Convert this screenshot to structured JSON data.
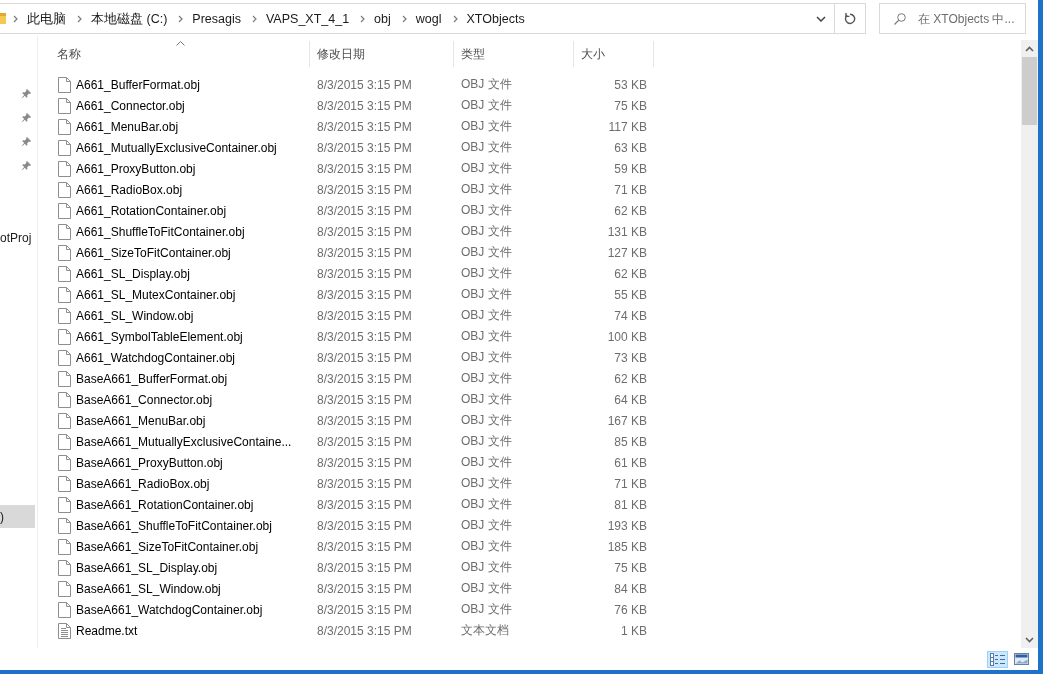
{
  "address_bar": {
    "breadcrumb": [
      "此电脑",
      "本地磁盘 (C:)",
      "Presagis",
      "VAPS_XT_4_1",
      "obj",
      "wogl",
      "XTObjects"
    ]
  },
  "search": {
    "placeholder": "在 XTObjects 中..."
  },
  "nav_pane": {
    "items": [
      {
        "kind": "pinned"
      },
      {
        "kind": "pinned"
      },
      {
        "kind": "pinned"
      },
      {
        "kind": "pinned"
      },
      {
        "kind": "folder",
        "label": "otProj",
        "selected": false
      },
      {
        "kind": "folder",
        "label": ")",
        "selected": true
      }
    ]
  },
  "table": {
    "columns": [
      {
        "label": "名称",
        "sorted": true
      },
      {
        "label": "修改日期",
        "sorted": false
      },
      {
        "label": "类型",
        "sorted": false
      },
      {
        "label": "大小",
        "sorted": false
      }
    ],
    "rows": [
      {
        "kind": "obj",
        "name": "A661_BufferFormat.obj",
        "modified": "8/3/2015 3:15 PM",
        "type": "OBJ 文件",
        "size": "53 KB"
      },
      {
        "kind": "obj",
        "name": "A661_Connector.obj",
        "modified": "8/3/2015 3:15 PM",
        "type": "OBJ 文件",
        "size": "75 KB"
      },
      {
        "kind": "obj",
        "name": "A661_MenuBar.obj",
        "modified": "8/3/2015 3:15 PM",
        "type": "OBJ 文件",
        "size": "117 KB"
      },
      {
        "kind": "obj",
        "name": "A661_MutuallyExclusiveContainer.obj",
        "modified": "8/3/2015 3:15 PM",
        "type": "OBJ 文件",
        "size": "63 KB"
      },
      {
        "kind": "obj",
        "name": "A661_ProxyButton.obj",
        "modified": "8/3/2015 3:15 PM",
        "type": "OBJ 文件",
        "size": "59 KB"
      },
      {
        "kind": "obj",
        "name": "A661_RadioBox.obj",
        "modified": "8/3/2015 3:15 PM",
        "type": "OBJ 文件",
        "size": "71 KB"
      },
      {
        "kind": "obj",
        "name": "A661_RotationContainer.obj",
        "modified": "8/3/2015 3:15 PM",
        "type": "OBJ 文件",
        "size": "62 KB"
      },
      {
        "kind": "obj",
        "name": "A661_ShuffleToFitContainer.obj",
        "modified": "8/3/2015 3:15 PM",
        "type": "OBJ 文件",
        "size": "131 KB"
      },
      {
        "kind": "obj",
        "name": "A661_SizeToFitContainer.obj",
        "modified": "8/3/2015 3:15 PM",
        "type": "OBJ 文件",
        "size": "127 KB"
      },
      {
        "kind": "obj",
        "name": "A661_SL_Display.obj",
        "modified": "8/3/2015 3:15 PM",
        "type": "OBJ 文件",
        "size": "62 KB"
      },
      {
        "kind": "obj",
        "name": "A661_SL_MutexContainer.obj",
        "modified": "8/3/2015 3:15 PM",
        "type": "OBJ 文件",
        "size": "55 KB"
      },
      {
        "kind": "obj",
        "name": "A661_SL_Window.obj",
        "modified": "8/3/2015 3:15 PM",
        "type": "OBJ 文件",
        "size": "74 KB"
      },
      {
        "kind": "obj",
        "name": "A661_SymbolTableElement.obj",
        "modified": "8/3/2015 3:15 PM",
        "type": "OBJ 文件",
        "size": "100 KB"
      },
      {
        "kind": "obj",
        "name": "A661_WatchdogContainer.obj",
        "modified": "8/3/2015 3:15 PM",
        "type": "OBJ 文件",
        "size": "73 KB"
      },
      {
        "kind": "obj",
        "name": "BaseA661_BufferFormat.obj",
        "modified": "8/3/2015 3:15 PM",
        "type": "OBJ 文件",
        "size": "62 KB"
      },
      {
        "kind": "obj",
        "name": "BaseA661_Connector.obj",
        "modified": "8/3/2015 3:15 PM",
        "type": "OBJ 文件",
        "size": "64 KB"
      },
      {
        "kind": "obj",
        "name": "BaseA661_MenuBar.obj",
        "modified": "8/3/2015 3:15 PM",
        "type": "OBJ 文件",
        "size": "167 KB"
      },
      {
        "kind": "obj",
        "name": "BaseA661_MutuallyExclusiveContaine...",
        "modified": "8/3/2015 3:15 PM",
        "type": "OBJ 文件",
        "size": "85 KB"
      },
      {
        "kind": "obj",
        "name": "BaseA661_ProxyButton.obj",
        "modified": "8/3/2015 3:15 PM",
        "type": "OBJ 文件",
        "size": "61 KB"
      },
      {
        "kind": "obj",
        "name": "BaseA661_RadioBox.obj",
        "modified": "8/3/2015 3:15 PM",
        "type": "OBJ 文件",
        "size": "71 KB"
      },
      {
        "kind": "obj",
        "name": "BaseA661_RotationContainer.obj",
        "modified": "8/3/2015 3:15 PM",
        "type": "OBJ 文件",
        "size": "81 KB"
      },
      {
        "kind": "obj",
        "name": "BaseA661_ShuffleToFitContainer.obj",
        "modified": "8/3/2015 3:15 PM",
        "type": "OBJ 文件",
        "size": "193 KB"
      },
      {
        "kind": "obj",
        "name": "BaseA661_SizeToFitContainer.obj",
        "modified": "8/3/2015 3:15 PM",
        "type": "OBJ 文件",
        "size": "185 KB"
      },
      {
        "kind": "obj",
        "name": "BaseA661_SL_Display.obj",
        "modified": "8/3/2015 3:15 PM",
        "type": "OBJ 文件",
        "size": "75 KB"
      },
      {
        "kind": "obj",
        "name": "BaseA661_SL_Window.obj",
        "modified": "8/3/2015 3:15 PM",
        "type": "OBJ 文件",
        "size": "84 KB"
      },
      {
        "kind": "obj",
        "name": "BaseA661_WatchdogContainer.obj",
        "modified": "8/3/2015 3:15 PM",
        "type": "OBJ 文件",
        "size": "76 KB"
      },
      {
        "kind": "txt",
        "name": "Readme.txt",
        "modified": "8/3/2015 3:15 PM",
        "type": "文本文档",
        "size": "1 KB"
      }
    ]
  },
  "view_buttons": [
    {
      "kind": "details",
      "selected": true
    },
    {
      "kind": "large_icons",
      "selected": false
    }
  ]
}
